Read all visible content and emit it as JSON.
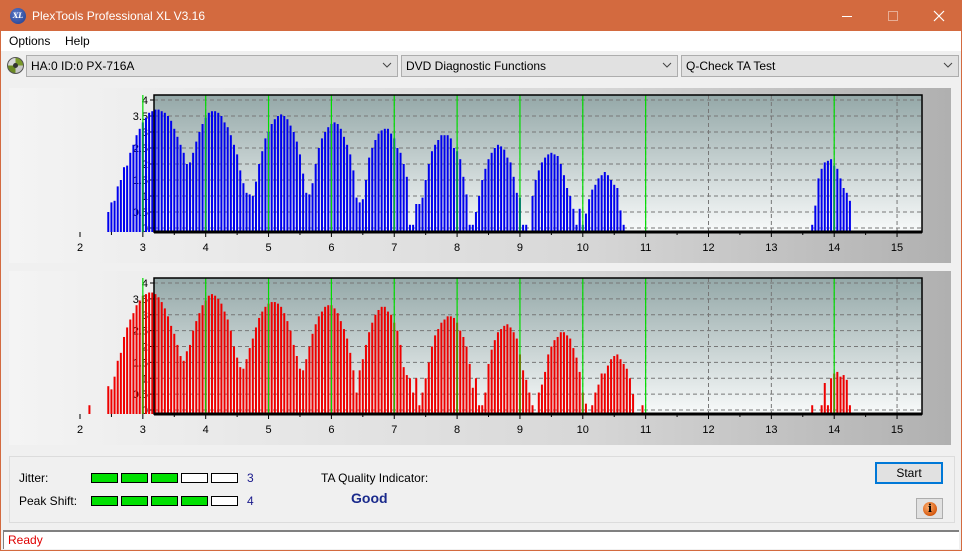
{
  "window": {
    "title": "PlexTools Professional XL V3.16",
    "app_icon_label": "XL",
    "controls": {
      "minimize": "minimize-icon",
      "maximize": "maximize-icon",
      "close": "close-icon"
    }
  },
  "menu": {
    "items": [
      "Options",
      "Help"
    ]
  },
  "toolbar": {
    "drive_icon": "disc-drive-icon",
    "drive_select": "HA:0 ID:0  PX-716A",
    "function_select": "DVD Diagnostic Functions",
    "test_select": "Q-Check TA Test"
  },
  "colors": {
    "title_bar": "#d36a3f",
    "top_bars": "#0000ee",
    "bottom_bars": "#ee0000",
    "marker_lines": "#00dd00",
    "meter_on": "#00e000",
    "quality_text": "#1a2a8c",
    "status_text": "#e00000"
  },
  "chart_data": [
    {
      "type": "bar",
      "name": "ta-top-chart",
      "title": "",
      "xlabel": "",
      "ylabel": "",
      "xlim": [
        1.6,
        15.4
      ],
      "ylim": [
        -0.15,
        4.15
      ],
      "x_ticks": [
        "2",
        "3",
        "4",
        "5",
        "6",
        "7",
        "8",
        "9",
        "10",
        "11",
        "12",
        "13",
        "14",
        "15"
      ],
      "y_ticks": [
        "0",
        "0.5",
        "1",
        "1.5",
        "2",
        "2.5",
        "3",
        "3.5",
        "4"
      ],
      "grid": true,
      "marker_lines_x": [
        3,
        4,
        5,
        6,
        7,
        8,
        9,
        10,
        11,
        14
      ],
      "bar_step": 0.05,
      "x_start": 2.45,
      "values": [
        0.5,
        0.8,
        0.85,
        1.3,
        1.5,
        1.9,
        1.95,
        2.35,
        2.6,
        2.9,
        3.1,
        3.3,
        3.45,
        3.6,
        3.65,
        3.7,
        3.7,
        3.65,
        3.6,
        3.5,
        3.35,
        3.1,
        2.85,
        2.6,
        2.35,
        2.0,
        2.05,
        2.35,
        2.7,
        3.0,
        3.25,
        3.45,
        3.6,
        3.65,
        3.65,
        3.6,
        3.5,
        3.3,
        3.15,
        2.9,
        2.6,
        2.3,
        1.8,
        1.4,
        1.1,
        1.05,
        1.0,
        1.45,
        2.0,
        2.4,
        2.8,
        3.0,
        3.25,
        3.4,
        3.5,
        3.55,
        3.5,
        3.4,
        3.2,
        3.0,
        2.7,
        2.3,
        1.7,
        1.1,
        1.05,
        1.4,
        2.0,
        2.5,
        2.8,
        3.0,
        3.15,
        3.25,
        3.3,
        3.25,
        3.1,
        2.85,
        2.6,
        2.3,
        1.8,
        0.95,
        0.8,
        0.9,
        1.5,
        2.2,
        2.5,
        2.75,
        2.95,
        3.05,
        3.1,
        3.1,
        2.95,
        2.8,
        2.5,
        2.35,
        2.0,
        1.6,
        0.1,
        0.1,
        0.75,
        0.75,
        0.95,
        1.5,
        2.0,
        2.4,
        2.6,
        2.75,
        2.9,
        2.9,
        2.9,
        2.8,
        2.5,
        2.4,
        2.15,
        1.6,
        1.05,
        0.1,
        0.1,
        0.5,
        1.0,
        1.5,
        1.85,
        2.15,
        2.35,
        2.5,
        2.6,
        2.55,
        2.45,
        2.2,
        2.05,
        1.6,
        1.1,
        0.95,
        0.1,
        0.1,
        0,
        1.0,
        1.5,
        1.8,
        2.05,
        2.2,
        2.3,
        2.35,
        2.3,
        2.25,
        2.0,
        1.65,
        1.25,
        1.0,
        0.6,
        0.1,
        0.6,
        0.1,
        0.45,
        0.9,
        1.2,
        1.35,
        1.55,
        1.65,
        1.75,
        1.65,
        1.5,
        1.35,
        1.25,
        0.55,
        0.1
      ],
      "tail_segment": {
        "x_start": 13.65,
        "values": [
          0.1,
          0.7,
          1.55,
          1.85,
          2.05,
          2.1,
          2.15,
          1.95,
          1.85,
          1.55,
          1.25,
          1.1,
          0.85
        ]
      }
    },
    {
      "type": "bar",
      "name": "ta-bottom-chart",
      "title": "",
      "xlabel": "",
      "ylabel": "",
      "xlim": [
        1.6,
        15.4
      ],
      "ylim": [
        -0.15,
        4.15
      ],
      "x_ticks": [
        "2",
        "3",
        "4",
        "5",
        "6",
        "7",
        "8",
        "9",
        "10",
        "11",
        "12",
        "13",
        "14",
        "15"
      ],
      "y_ticks": [
        "0",
        "0.5",
        "1",
        "1.5",
        "2",
        "2.5",
        "3",
        "3.5",
        "4"
      ],
      "grid": true,
      "marker_lines_x": [
        3,
        4,
        5,
        6,
        7,
        8,
        9,
        10,
        11,
        14
      ],
      "bar_step": 0.05,
      "x_start": 2.45,
      "pre_bars": [
        {
          "x": 2.15,
          "value": 0.15
        }
      ],
      "values": [
        0.75,
        0.65,
        1.05,
        1.55,
        1.8,
        2.3,
        2.6,
        2.85,
        3.05,
        3.3,
        3.45,
        3.6,
        3.65,
        3.7,
        3.7,
        3.65,
        3.55,
        3.4,
        3.2,
        2.95,
        2.65,
        2.4,
        2.05,
        1.7,
        1.55,
        1.85,
        2.05,
        2.5,
        2.8,
        3.05,
        3.3,
        3.45,
        3.6,
        3.65,
        3.6,
        3.5,
        3.35,
        3.1,
        2.85,
        2.5,
        2.0,
        1.65,
        1.35,
        1.3,
        1.6,
        1.95,
        2.25,
        2.6,
        2.9,
        3.1,
        3.25,
        3.35,
        3.4,
        3.4,
        3.35,
        3.25,
        3.05,
        2.8,
        2.5,
        2.05,
        1.7,
        1.3,
        1.25,
        1.6,
        2.0,
        2.4,
        2.7,
        2.95,
        3.1,
        3.25,
        3.3,
        3.3,
        3.2,
        3.05,
        2.8,
        2.55,
        2.25,
        1.8,
        1.25,
        0.55,
        1.25,
        1.6,
        2.05,
        2.45,
        2.75,
        3.0,
        3.15,
        3.25,
        3.25,
        3.1,
        3.0,
        2.75,
        2.5,
        2.05,
        1.35,
        1.1,
        1.0,
        0.55,
        1.0,
        0.15,
        0.55,
        1.0,
        1.5,
        2.0,
        2.35,
        2.55,
        2.75,
        2.85,
        2.95,
        2.95,
        2.9,
        2.75,
        2.5,
        2.3,
        2.0,
        1.45,
        0.7,
        1.0,
        0.15,
        0.15,
        0.55,
        1.45,
        1.9,
        2.2,
        2.45,
        2.55,
        2.65,
        2.7,
        2.6,
        2.45,
        2.25,
        1.75,
        1.25,
        0.95,
        0.55,
        0.15,
        0,
        0.55,
        0.8,
        1.2,
        1.75,
        2.0,
        2.2,
        2.3,
        2.45,
        2.45,
        2.35,
        2.25,
        1.95,
        1.65,
        1.2,
        0.55,
        0.2,
        0,
        0.15,
        0.55,
        0.8,
        1.15,
        1.15,
        1.4,
        1.6,
        1.7,
        1.75,
        1.6,
        1.45,
        1.3,
        1.0,
        0.5,
        0,
        0,
        0.15
      ],
      "tail_segment": {
        "x_start": 13.65,
        "values": [
          0.15,
          0,
          0,
          0.15,
          0.85,
          0.15,
          1.0,
          1.15,
          1.2,
          1.05,
          1.1,
          0.95,
          0.15
        ]
      }
    }
  ],
  "metrics": {
    "jitter": {
      "label": "Jitter:",
      "value": "3",
      "level": 3,
      "max": 5
    },
    "peak_shift": {
      "label": "Peak Shift:",
      "value": "4",
      "level": 4,
      "max": 5
    },
    "quality_label": "TA Quality Indicator:",
    "quality_value": "Good"
  },
  "buttons": {
    "start": "Start",
    "info_icon": "info-icon"
  },
  "status": {
    "text": "Ready"
  }
}
